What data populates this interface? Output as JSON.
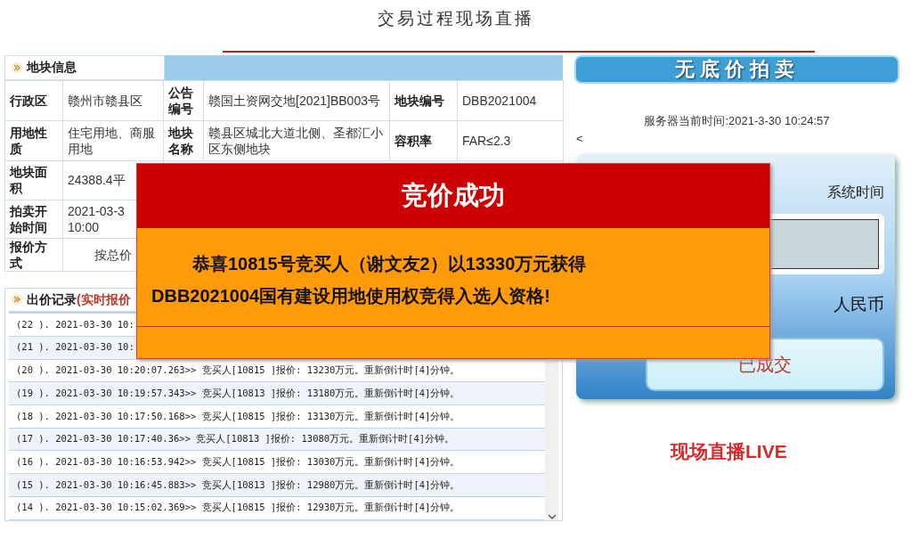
{
  "page_title": "交易过程现场直播",
  "land_info": {
    "title": "地块信息",
    "rows": [
      [
        {
          "kind": "label",
          "text": "行政区"
        },
        {
          "kind": "value",
          "text": "赣州市赣县区"
        },
        {
          "kind": "label",
          "text": "公告编号"
        },
        {
          "kind": "value",
          "text": "赣国土资网交地[2021]BB003号"
        },
        {
          "kind": "label",
          "text": "地块编号"
        },
        {
          "kind": "value",
          "text": "DBB2021004"
        }
      ],
      [
        {
          "kind": "label",
          "text": "用地性质"
        },
        {
          "kind": "value",
          "text": "住宅用地、商服用地"
        },
        {
          "kind": "label",
          "text": "地块名称"
        },
        {
          "kind": "value",
          "text": "赣县区城北大道北侧、圣都汇小区东侧地块"
        },
        {
          "kind": "label",
          "text": "容积率"
        },
        {
          "kind": "value",
          "text": "FAR≤2.3"
        }
      ],
      [
        {
          "kind": "label",
          "text": "地块面积"
        },
        {
          "kind": "value",
          "text": "24388.4平"
        }
      ],
      [
        {
          "kind": "label",
          "text": "拍卖开始时间"
        },
        {
          "kind": "value",
          "text": "2021-03-3 10:00"
        }
      ],
      [
        {
          "kind": "label",
          "text": "报价方式"
        },
        {
          "kind": "center",
          "text": "按总价"
        }
      ]
    ]
  },
  "bid_records": {
    "title": "出价记录",
    "subtitle": "(实时报价",
    "rows": [
      "(22 ). 2021-03-30 10:",
      "(21 ). 2021-03-30 10:",
      "(20 ). 2021-03-30 10:20:07.263>> 竞买人[10815 ]报价: 13230万元。重新倒计时[4]分钟。",
      "(19 ). 2021-03-30 10:19:57.343>> 竞买人[10813 ]报价: 13180万元。重新倒计时[4]分钟。",
      "(18 ). 2021-03-30 10:17:50.168>> 竞买人[10815 ]报价: 13130万元。重新倒计时[4]分钟。",
      "(17 ). 2021-03-30 10:17:40.36>> 竞买人[10813 ]报价: 13080万元。重新倒计时[4]分钟。",
      "(16 ). 2021-03-30 10:16:53.942>> 竞买人[10815 ]报价: 13030万元。重新倒计时[4]分钟。",
      "(15 ). 2021-03-30 10:16:45.883>> 竞买人[10813 ]报价: 12980万元。重新倒计时[4]分钟。",
      "(14 ). 2021-03-30 10:15:02.369>> 竞买人[10815 ]报价: 12930万元。重新倒计时[4]分钟。"
    ]
  },
  "auction": {
    "banner": "无底价拍卖",
    "server_time": "服务器当前时间:2021-3-30 10:24:57",
    "back": "<",
    "system_time_label": "系统时间",
    "currency": "人民币",
    "status_button": "已成交"
  },
  "live_label": "现场直播LIVE",
  "result_dialog": {
    "title": "竞价成功",
    "lines": [
      "恭喜10815号竞买人（谢文友2）以13330万元获得",
      "DBB2021004国有建设用地使用权竞得入选人资格!"
    ]
  }
}
